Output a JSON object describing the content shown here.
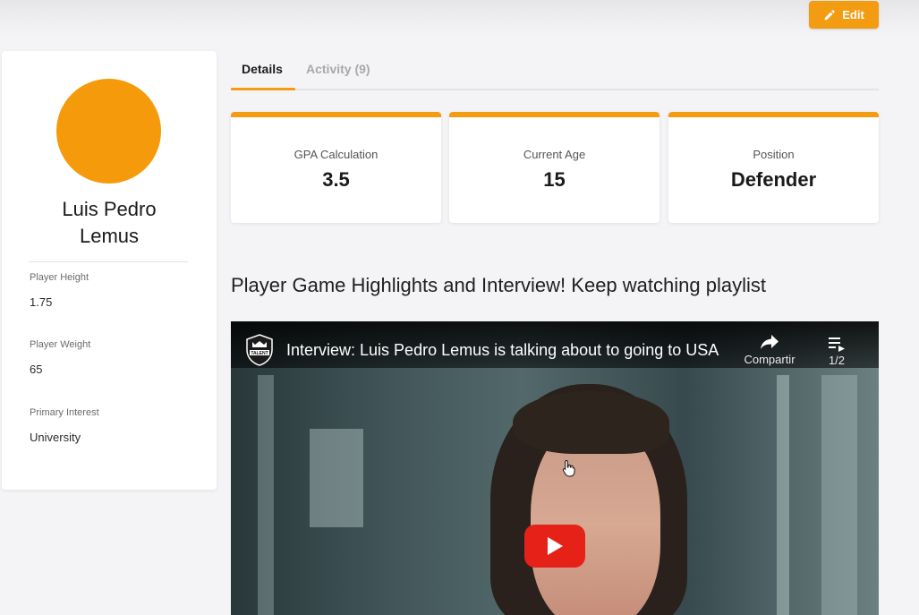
{
  "toolbar": {
    "edit_label": "Edit"
  },
  "profile": {
    "name": "Luis Pedro Lemus",
    "avatar_color": "#f59a0b",
    "fields": [
      {
        "label": "Player Height",
        "value": "1.75"
      },
      {
        "label": "Player Weight",
        "value": "65"
      },
      {
        "label": "Primary Interest",
        "value": "University"
      }
    ]
  },
  "tabs": [
    {
      "label": "Details",
      "active": true
    },
    {
      "label": "Activity (9)",
      "active": false
    }
  ],
  "stats": [
    {
      "label": "GPA Calculation",
      "value": "3.5"
    },
    {
      "label": "Current Age",
      "value": "15"
    },
    {
      "label": "Position",
      "value": "Defender"
    }
  ],
  "section": {
    "title": "Player Game Highlights and Interview! Keep watching playlist"
  },
  "video": {
    "title": "Interview: Luis Pedro Lemus is talking about to going to USA",
    "share_label": "Compartir",
    "playlist_count": "1/2",
    "channel_logo_text": "TALENT"
  },
  "colors": {
    "accent": "#f39c12",
    "play_red": "#e62117"
  }
}
